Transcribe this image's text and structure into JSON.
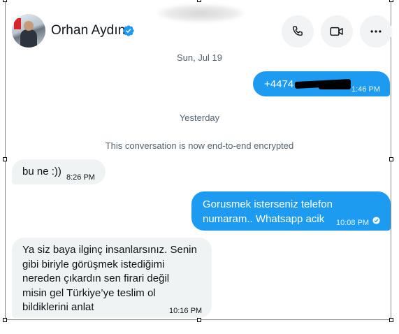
{
  "header": {
    "contact_name": "Orhan Aydın",
    "verified_icon": "verified-badge-icon",
    "actions": [
      {
        "name": "call-button",
        "icon": "phone-icon"
      },
      {
        "name": "video-call-button",
        "icon": "video-camera-icon"
      },
      {
        "name": "more-options-button",
        "icon": "more-horizontal-icon"
      }
    ]
  },
  "conversation": {
    "date_1": "Sun, Jul 19",
    "msg_1": {
      "text": "+4474",
      "time": "1:46 PM",
      "direction": "outgoing"
    },
    "date_2": "Yesterday",
    "encryption_notice": "This conversation is now end-to-end encrypted",
    "msg_2": {
      "text": "bu ne :))",
      "time": "8:26 PM",
      "direction": "incoming"
    },
    "msg_3": {
      "line1": "Gorusmek isterseniz telefon",
      "line2": "numaram.. Whatsapp acik",
      "time": "10:08 PM",
      "direction": "outgoing"
    },
    "msg_4": {
      "line1": "Ya siz baya ilginç insanlarsınız. Senin",
      "line2": "gibi biriyle görüşmek istediğimi",
      "line3": "nereden çıkardın sen firari değil",
      "line4": "misin gel Türkiye’ye teslim ol",
      "line5": "bildiklerini anlat",
      "time": "10:16 PM",
      "direction": "incoming"
    }
  },
  "colors": {
    "accent": "#1d9bf0",
    "incoming_bubble": "#eff3f4",
    "secondary_text": "#536471"
  }
}
